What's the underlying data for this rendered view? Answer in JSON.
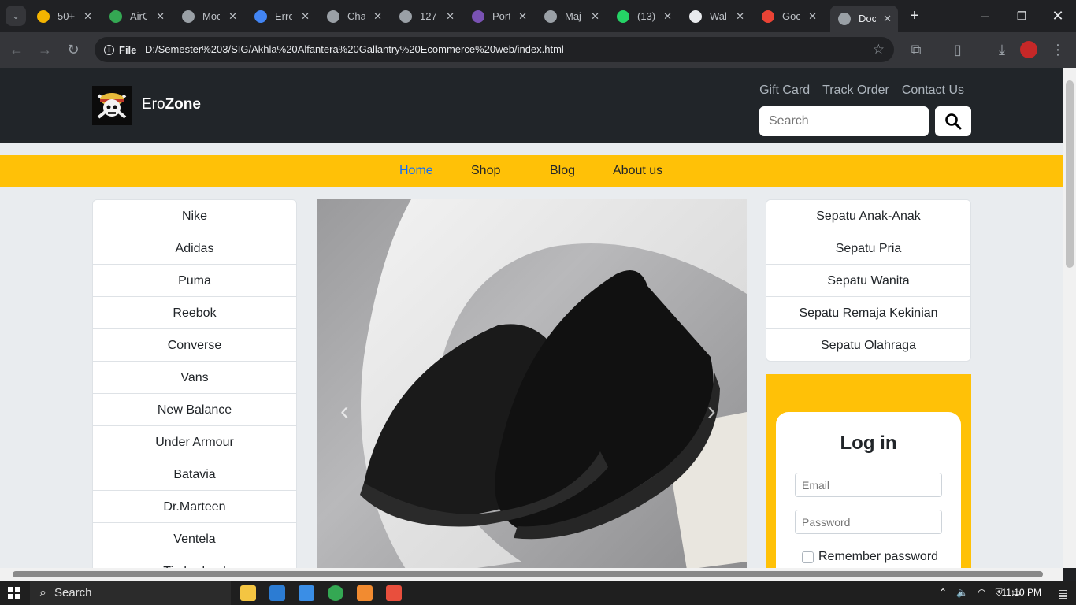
{
  "browser": {
    "tabs": [
      {
        "title": "50+",
        "color": "#f4b400"
      },
      {
        "title": "AirC",
        "color": "#34a853"
      },
      {
        "title": "Moc",
        "color": "#9aa0a6"
      },
      {
        "title": "Erro",
        "color": "#4285f4"
      },
      {
        "title": "Cha",
        "color": "#9aa0a6"
      },
      {
        "title": "127",
        "color": "#9aa0a6"
      },
      {
        "title": "Port",
        "color": "#7952b3"
      },
      {
        "title": "Maj",
        "color": "#9aa0a6"
      },
      {
        "title": "(13)",
        "color": "#25d366"
      },
      {
        "title": "Wal",
        "color": "#e8eaed"
      },
      {
        "title": "Goc",
        "color": "#ea4335"
      },
      {
        "title": "Doc",
        "color": "#9aa0a6"
      }
    ],
    "omnibox_chip": "File",
    "url": "D:/Semester%203/SIG/Akhla%20Alfantera%20Gallantry%20Ecommerce%20web/index.html"
  },
  "site": {
    "brand_prefix": "Ero",
    "brand_bold": "Zone",
    "top_links": [
      "Gift Card",
      "Track Order",
      "Contact Us"
    ],
    "search_placeholder": "Search",
    "nav": [
      "Home",
      "Shop",
      "Blog",
      "About us"
    ],
    "brands": [
      "Nike",
      "Adidas",
      "Puma",
      "Reebok",
      "Converse",
      "Vans",
      "New Balance",
      "Under Armour",
      "Batavia",
      "Dr.Marteen",
      "Ventela",
      "Timberland"
    ],
    "categories": [
      "Sepatu Anak-Anak",
      "Sepatu Pria",
      "Sepatu Wanita",
      "Sepatu Remaja Kekinian",
      "Sepatu Olahraga"
    ],
    "login": {
      "title": "Log in",
      "email_placeholder": "Email",
      "password_placeholder": "Password",
      "remember_label": "Remember password"
    }
  },
  "taskbar": {
    "search_label": "Search",
    "time": "11:10 PM"
  }
}
